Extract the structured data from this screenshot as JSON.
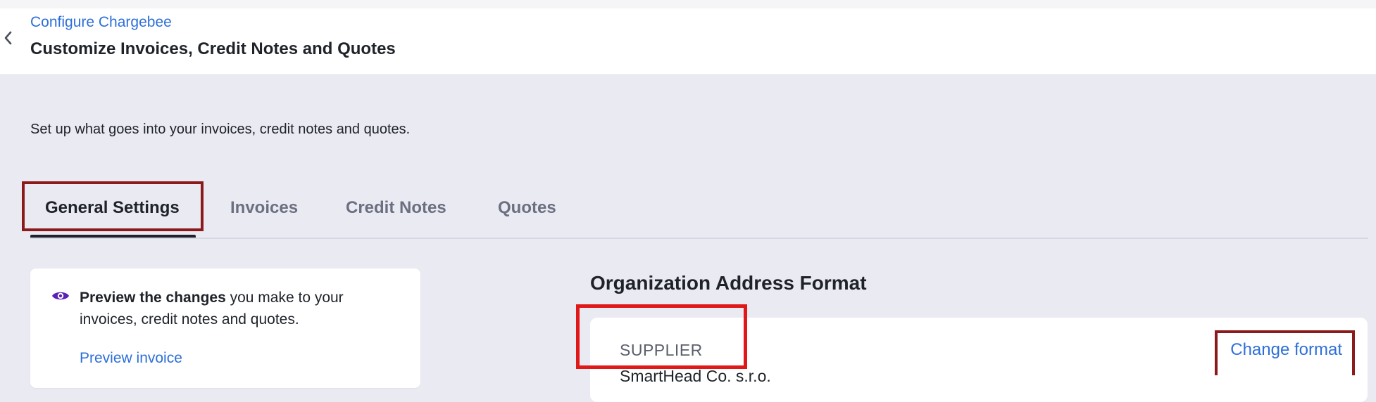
{
  "header": {
    "breadcrumb": "Configure Chargebee",
    "title": "Customize Invoices, Credit Notes and Quotes"
  },
  "subtitle": "Set up what goes into your invoices, credit notes and quotes.",
  "tabs": [
    {
      "label": "General Settings",
      "active": true
    },
    {
      "label": "Invoices",
      "active": false
    },
    {
      "label": "Credit Notes",
      "active": false
    },
    {
      "label": "Quotes",
      "active": false
    }
  ],
  "preview": {
    "bold": "Preview the changes",
    "text": " you make to your invoices, credit notes and quotes.",
    "link": "Preview invoice",
    "icon": "eye-icon"
  },
  "address_format": {
    "title": "Organization Address Format",
    "label": "SUPPLIER",
    "company": "SmartHead Co. s.r.o.",
    "change_link": "Change format"
  },
  "colors": {
    "link": "#2d6fd9",
    "page_bg": "#eaeaf3",
    "eye": "#5b21b6",
    "highlight_dark": "#8b1a1a",
    "highlight_red": "#e01818"
  }
}
